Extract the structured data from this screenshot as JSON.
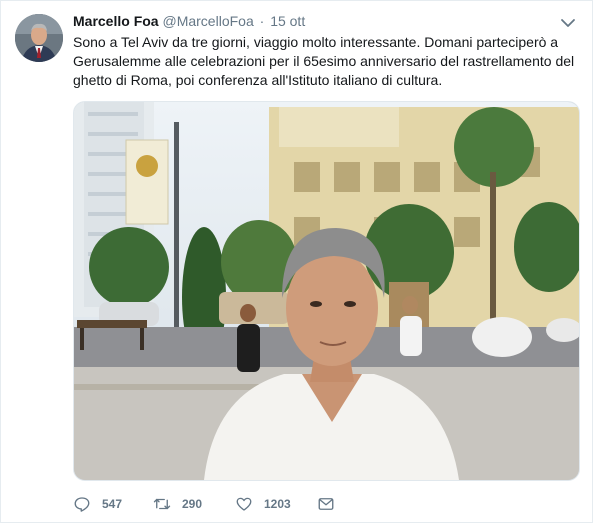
{
  "tweet": {
    "author": {
      "fullname": "Marcello Foa",
      "username": "@MarcelloFoa",
      "separator": "·",
      "timestamp": "15 ott"
    },
    "text": "Sono a Tel Aviv da tre giorni, viaggio molto interessante. Domani parteciperò a Gerusalemme alle celebrazioni per il 65esimo anniversario del rastrellamento del ghetto di Roma, poi conferenza all'Istituto italiano di cultura.",
    "media": {
      "kind": "photo",
      "icon": "photo-image"
    },
    "actions": {
      "reply_count": "547",
      "retweet_count": "290",
      "like_count": "1203"
    }
  },
  "colors": {
    "text_primary": "#14171a",
    "text_secondary": "#657786",
    "border": "#e6ecf0"
  },
  "icons": {
    "more": "chevron-down-icon",
    "reply": "reply-icon",
    "retweet": "retweet-icon",
    "like": "heart-icon",
    "dm": "envelope-icon"
  }
}
